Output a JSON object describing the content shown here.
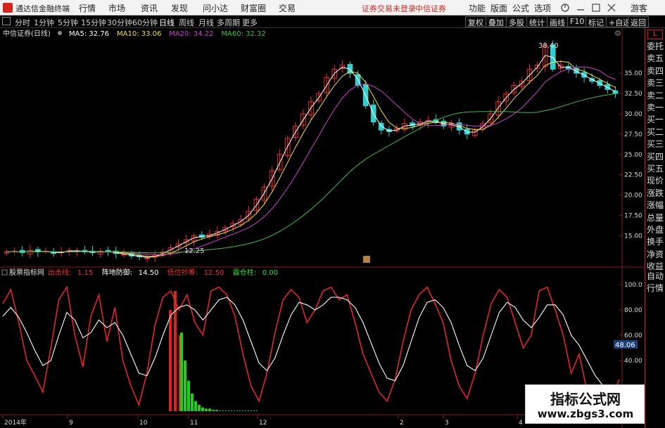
{
  "titlebar": {
    "app_name": "通达信金融终端",
    "menus": [
      "行情",
      "市场",
      "资讯",
      "发现",
      "问小达",
      "财富圈",
      "交易"
    ],
    "notice_1": "证券交易未登录",
    "notice_2": "中信证券",
    "right_buttons": [
      "功能",
      "版面",
      "公式",
      "选项"
    ],
    "guest": "游客"
  },
  "toolbar": {
    "periods": [
      "分时",
      "1分钟",
      "5分钟",
      "15分钟",
      "30分钟",
      "60分钟",
      "日线",
      "周线",
      "月线",
      "多周期",
      "更多"
    ],
    "active_period": "日线",
    "right_buttons": [
      "复权",
      "叠加",
      "多股",
      "统计",
      "画线",
      "F10",
      "标记",
      "+自选",
      "返回"
    ]
  },
  "main_chart": {
    "stock_title": "中信证券(日线)",
    "ma_labels": [
      {
        "text": "MA5: 32.76",
        "color": "#ffffff"
      },
      {
        "text": "MA10: 33.06",
        "color": "#f0e040"
      },
      {
        "text": "MA20: 34.22",
        "color": "#d040d0"
      },
      {
        "text": "MA60: 32.32",
        "color": "#40c040"
      }
    ],
    "price_ticks": [
      "35.00",
      "32.50",
      "30.00",
      "27.50",
      "25.00",
      "22.50",
      "20.00",
      "17.50",
      "15.00"
    ],
    "high_mark": "38.40",
    "low_mark": "12.25"
  },
  "indicator": {
    "name": "股票指标网",
    "items": [
      {
        "label": "出击线:",
        "value": "1.15",
        "color": "#e33"
      },
      {
        "label": "阵地防御:",
        "value": "14.50",
        "color": "#ffffff"
      },
      {
        "label": "低位抄筹:",
        "value": "12.50",
        "color": "#e33"
      },
      {
        "label": "震仓柱:",
        "value": "0.00",
        "color": "#33dd33"
      }
    ],
    "ticks": [
      "100.0",
      "80.00",
      "60.00",
      "40.00"
    ],
    "current_value": "48.06"
  },
  "time_axis": [
    "2014年",
    "9",
    "10",
    "11",
    "12",
    "2",
    "3",
    "4"
  ],
  "right_sidebar": {
    "badge": "L",
    "items": [
      "委托",
      "卖五",
      "卖四",
      "卖三",
      "卖二",
      "卖一",
      "买一",
      "买二",
      "买三",
      "买四",
      "买五",
      "现价",
      "涨跌",
      "涨幅",
      "总量",
      "外盘",
      "换手",
      "净资",
      "收益"
    ],
    "bottom_items": [
      "自动",
      "行情"
    ]
  },
  "watermark": {
    "line1": "指标公式网",
    "line2": "www.zbgs3.com"
  },
  "chart_data": {
    "type": "line",
    "price_series": {
      "name": "price",
      "ylim": [
        12.0,
        39.0
      ],
      "low": 12.25,
      "high": 38.4,
      "values": [
        13.0,
        13.1,
        12.9,
        13.2,
        13.0,
        13.1,
        12.8,
        13.0,
        13.2,
        13.1,
        13.0,
        12.9,
        13.1,
        13.0,
        12.8,
        12.7,
        12.5,
        12.4,
        12.25,
        12.6,
        13.0,
        13.5,
        14.0,
        14.5,
        15.0,
        14.8,
        15.2,
        15.5,
        16.0,
        16.5,
        17.0,
        18.0,
        19.5,
        21.0,
        23.0,
        25.0,
        27.0,
        28.5,
        30.0,
        31.5,
        32.5,
        34.5,
        35.5,
        36.0,
        35.0,
        33.5,
        31.0,
        29.0,
        28.0,
        27.8,
        28.2,
        28.8,
        28.5,
        29.0,
        29.2,
        29.0,
        28.5,
        28.8,
        28.0,
        27.5,
        28.0,
        28.8,
        30.0,
        31.5,
        32.5,
        33.5,
        34.0,
        35.5,
        36.0,
        38.4,
        35.5,
        36.0,
        35.5,
        35.0,
        34.5,
        34.0,
        33.5,
        33.0,
        32.5
      ]
    },
    "indicator_series": {
      "name": "indicator",
      "ylim": [
        0,
        105
      ],
      "red_values": [
        85,
        96,
        70,
        40,
        28,
        15,
        50,
        88,
        98,
        60,
        35,
        75,
        92,
        55,
        82,
        40,
        20,
        5,
        30,
        68,
        90,
        95,
        80,
        92,
        70,
        60,
        95,
        98,
        92,
        75,
        45,
        20,
        8,
        30,
        62,
        88,
        96,
        90,
        70,
        80,
        95,
        98,
        88,
        92,
        70,
        45,
        30,
        15,
        8,
        25,
        55,
        80,
        92,
        98,
        85,
        70,
        40,
        20,
        10,
        30,
        60,
        85,
        96,
        90,
        70,
        50,
        60,
        95,
        98,
        80,
        60,
        30,
        45,
        15,
        8,
        5,
        10,
        25
      ],
      "white_values": [
        75,
        82,
        74,
        62,
        48,
        36,
        40,
        60,
        78,
        72,
        58,
        62,
        72,
        66,
        70,
        60,
        45,
        30,
        28,
        42,
        60,
        76,
        82,
        84,
        80,
        72,
        80,
        88,
        90,
        84,
        72,
        55,
        38,
        32,
        42,
        60,
        76,
        86,
        84,
        80,
        84,
        90,
        90,
        88,
        82,
        70,
        54,
        38,
        26,
        24,
        36,
        55,
        74,
        86,
        88,
        82,
        70,
        52,
        36,
        32,
        42,
        60,
        78,
        86,
        82,
        72,
        66,
        74,
        84,
        84,
        76,
        60,
        52,
        40,
        28,
        20,
        18,
        20
      ],
      "green_bars": [
        62,
        40,
        24,
        14,
        8,
        5,
        3,
        2,
        2,
        1,
        1
      ],
      "red_bars": [
        80,
        95,
        60
      ]
    }
  }
}
